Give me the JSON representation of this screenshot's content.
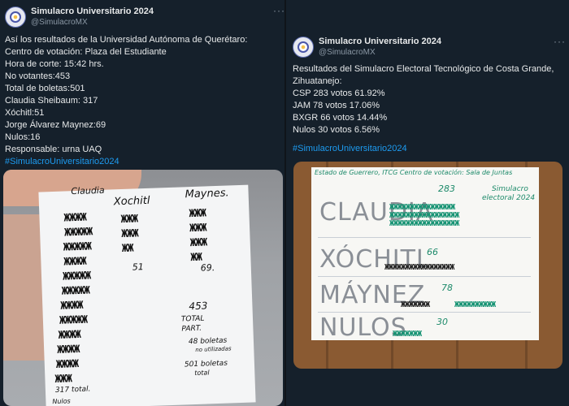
{
  "left_tweet": {
    "display_name": "Simulacro Universitario 2024",
    "handle": "@SimulacroMX",
    "lines": [
      "Así los resultados de la Universidad Autónoma de Querétaro:",
      "Centro de votación: Plaza del Estudiante",
      "Hora de corte: 15:42 hrs.",
      "No votantes:453",
      "Total de boletas:501",
      "Claudia Sheibaum: 317",
      "Xóchitl:51",
      "Jorge Álvarez Maynez:69",
      "Nulos:16",
      "Responsable: urna UAQ"
    ],
    "hashtag": "#SimulacroUniversitario2024",
    "photo": {
      "header_claudia": "Claudia",
      "header_xochitl": "Xochitl",
      "header_maynez": "Maynes.",
      "count_xochitl": "51",
      "count_maynez": "69.",
      "no_votantes": "453",
      "total_part_1": "TOTAL",
      "total_part_2": "PART.",
      "no_utilizadas_1": "48 boletas",
      "no_utilizadas_2": "no utilizadas",
      "total_boletas_1": "501 boletas",
      "total_boletas_2": "total",
      "claudia_total": "317 total.",
      "nulos": "Nulos"
    }
  },
  "right_tweet": {
    "display_name": "Simulacro Universitario 2024",
    "handle": "@SimulacroMX",
    "lines": [
      "Resultados del Simulacro Electoral Tecnológico de Costa Grande,",
      "Zihuatanejo:",
      "CSP  283 votos  61.92%",
      "JAM  78 votos 17.06%",
      "BXGR  66 votos  14.44%",
      "Nulos  30 votos  6.56%"
    ],
    "hashtag": "#SimulacroUniversitario2024",
    "photo": {
      "header": "Estado de Guerrero, ITCG  Centro de votación: Sala de Juntas",
      "count_claudia": "283",
      "label_1": "Simulacro",
      "label_2": "electoral 2024",
      "cand_claudia": "CLAUDIA",
      "cand_xochitl": "XÓCHITL",
      "count_xochitl": "66",
      "cand_maynez": "MÁYNEZ",
      "count_maynez": "78",
      "cand_nulos": "NULOS",
      "count_nulos": "30"
    }
  },
  "more_glyph": "···"
}
